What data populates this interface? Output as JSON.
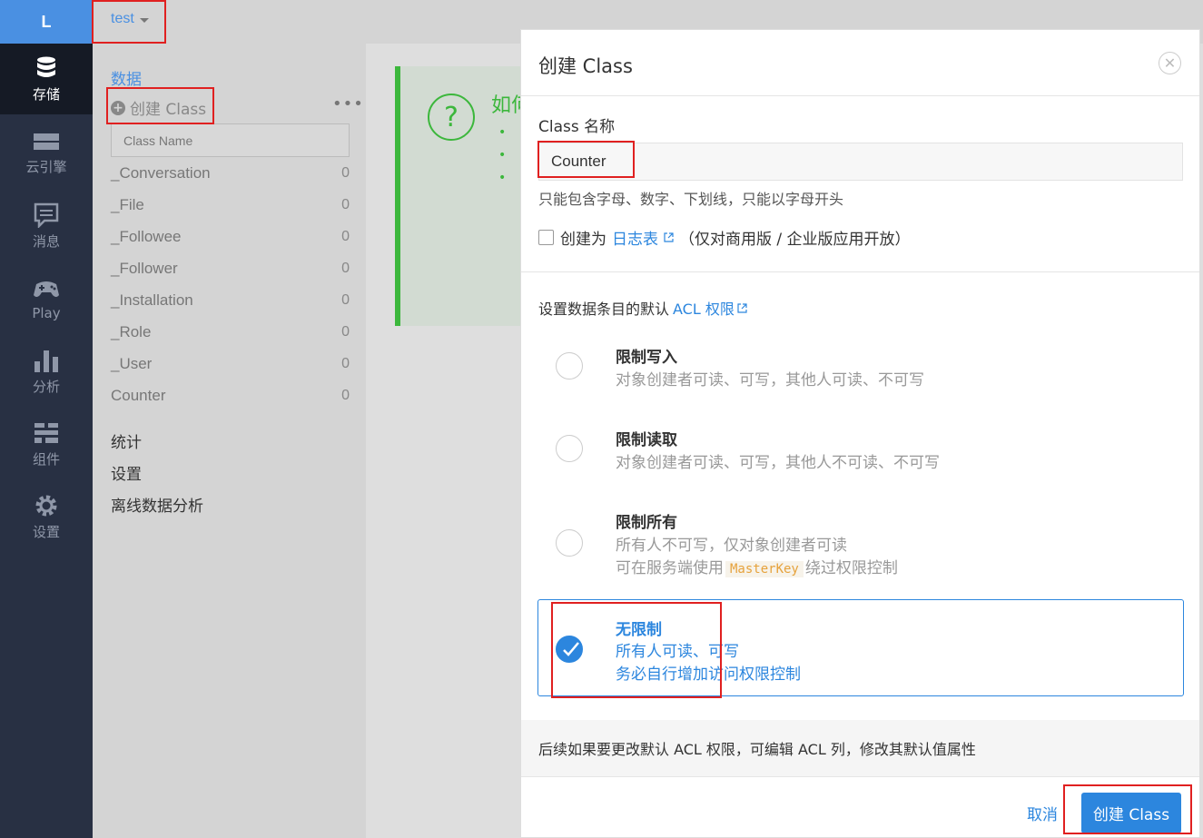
{
  "app": {
    "logo_letter": "L",
    "current_app": "test"
  },
  "leftnav": {
    "items": [
      {
        "label": "存储",
        "icon": "database-icon",
        "active": true
      },
      {
        "label": "云引擎",
        "icon": "server-icon",
        "active": false
      },
      {
        "label": "消息",
        "icon": "message-icon",
        "active": false
      },
      {
        "label": "Play",
        "icon": "gamepad-icon",
        "active": false
      },
      {
        "label": "分析",
        "icon": "bar-chart-icon",
        "active": false
      },
      {
        "label": "组件",
        "icon": "components-icon",
        "active": false
      },
      {
        "label": "设置",
        "icon": "gear-icon",
        "active": false
      }
    ]
  },
  "sidebar": {
    "section_title": "数据",
    "create_class_label": "创建 Class",
    "more_icon": "more-dots-icon",
    "filter_placeholder": "Class Name",
    "classes": [
      {
        "name": "_Conversation",
        "count": "0"
      },
      {
        "name": "_File",
        "count": "0"
      },
      {
        "name": "_Followee",
        "count": "0"
      },
      {
        "name": "_Follower",
        "count": "0"
      },
      {
        "name": "_Installation",
        "count": "0"
      },
      {
        "name": "_Role",
        "count": "0"
      },
      {
        "name": "_User",
        "count": "0"
      },
      {
        "name": "Counter",
        "count": "0"
      }
    ],
    "links": [
      "统计",
      "设置",
      "离线数据分析"
    ]
  },
  "main": {
    "guide_title": "如何",
    "guide_bullets": [
      "•",
      "•",
      "•"
    ]
  },
  "modal": {
    "title": "创建 Class",
    "close_icon": "close-icon",
    "name_label": "Class 名称",
    "name_value": "Counter",
    "name_hint": "只能包含字母、数字、下划线，只能以字母开头",
    "log_table": {
      "prefix": "创建为",
      "link": "日志表",
      "suffix": "（仅对商用版 / 企业版应用开放）",
      "checked": false
    },
    "acl": {
      "prefix": "设置数据条目的默认",
      "link": "ACL 权限"
    },
    "options": [
      {
        "title": "限制写入",
        "desc": [
          "对象创建者可读、可写，其他人可读、不可写"
        ],
        "selected": false
      },
      {
        "title": "限制读取",
        "desc": [
          "对象创建者可读、可写，其他人不可读、不可写"
        ],
        "selected": false
      },
      {
        "title": "限制所有",
        "desc": [
          "所有人不可写，仅对象创建者可读"
        ],
        "desc2_prefix": "可在服务端使用",
        "desc2_code": "MasterKey",
        "desc2_suffix": "绕过权限控制",
        "selected": false
      },
      {
        "title": "无限制",
        "desc": [
          "所有人可读、可写",
          "务必自行增加访问权限控制"
        ],
        "selected": true
      }
    ],
    "footer_note": "后续如果要更改默认 ACL 权限，可编辑 ACL 列，修改其默认值属性",
    "cancel_label": "取消",
    "submit_label": "创建 Class"
  },
  "colors": {
    "accent": "#2c86de",
    "nav_bg": "#283043",
    "guide_green": "#3cb73c",
    "annotation_red": "#e02020"
  }
}
